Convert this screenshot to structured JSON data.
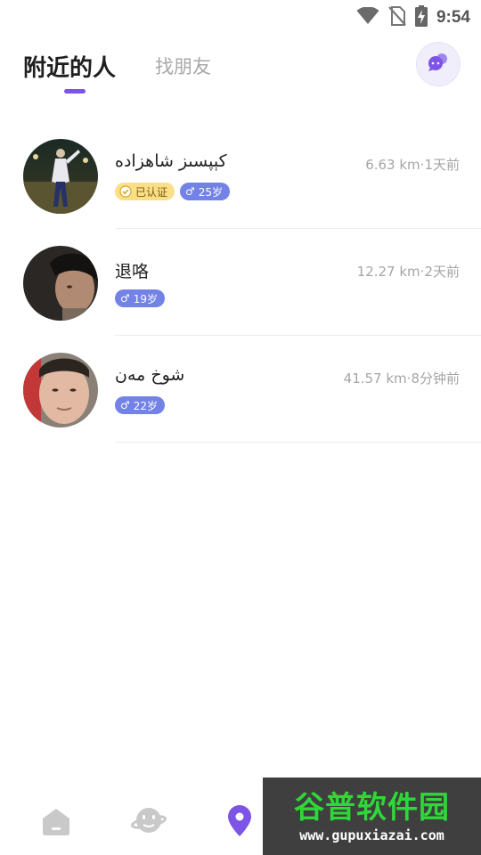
{
  "status_bar": {
    "time": "9:54",
    "icons": [
      "wifi-icon",
      "no-sim-icon",
      "battery-charging-icon"
    ]
  },
  "header": {
    "tab_active": "附近的人",
    "tab_inactive": "找朋友",
    "chat_icon": "chat-bubbles-icon",
    "accent_color": "#7c54e6"
  },
  "users": [
    {
      "name": "كېپسىز شاھزادە",
      "distance": "6.63 km",
      "separator": "·",
      "time": "1天前",
      "verified_label": "已认证",
      "gender_symbol": "♂",
      "age": "25岁"
    },
    {
      "name": "退咯",
      "distance": "12.27 km",
      "separator": "·",
      "time": "2天前",
      "gender_symbol": "♂",
      "age": "19岁"
    },
    {
      "name": "شوخ مەن",
      "distance": "41.57 km",
      "separator": "·",
      "time": "8分钟前",
      "gender_symbol": "♂",
      "age": "22岁"
    }
  ],
  "bottom_nav": {
    "items": [
      "home-icon",
      "planet-icon",
      "location-pin-icon"
    ],
    "active": "location-pin-icon"
  },
  "watermark": {
    "title": "谷普软件园",
    "url": "www.gupuxiazai.com"
  }
}
